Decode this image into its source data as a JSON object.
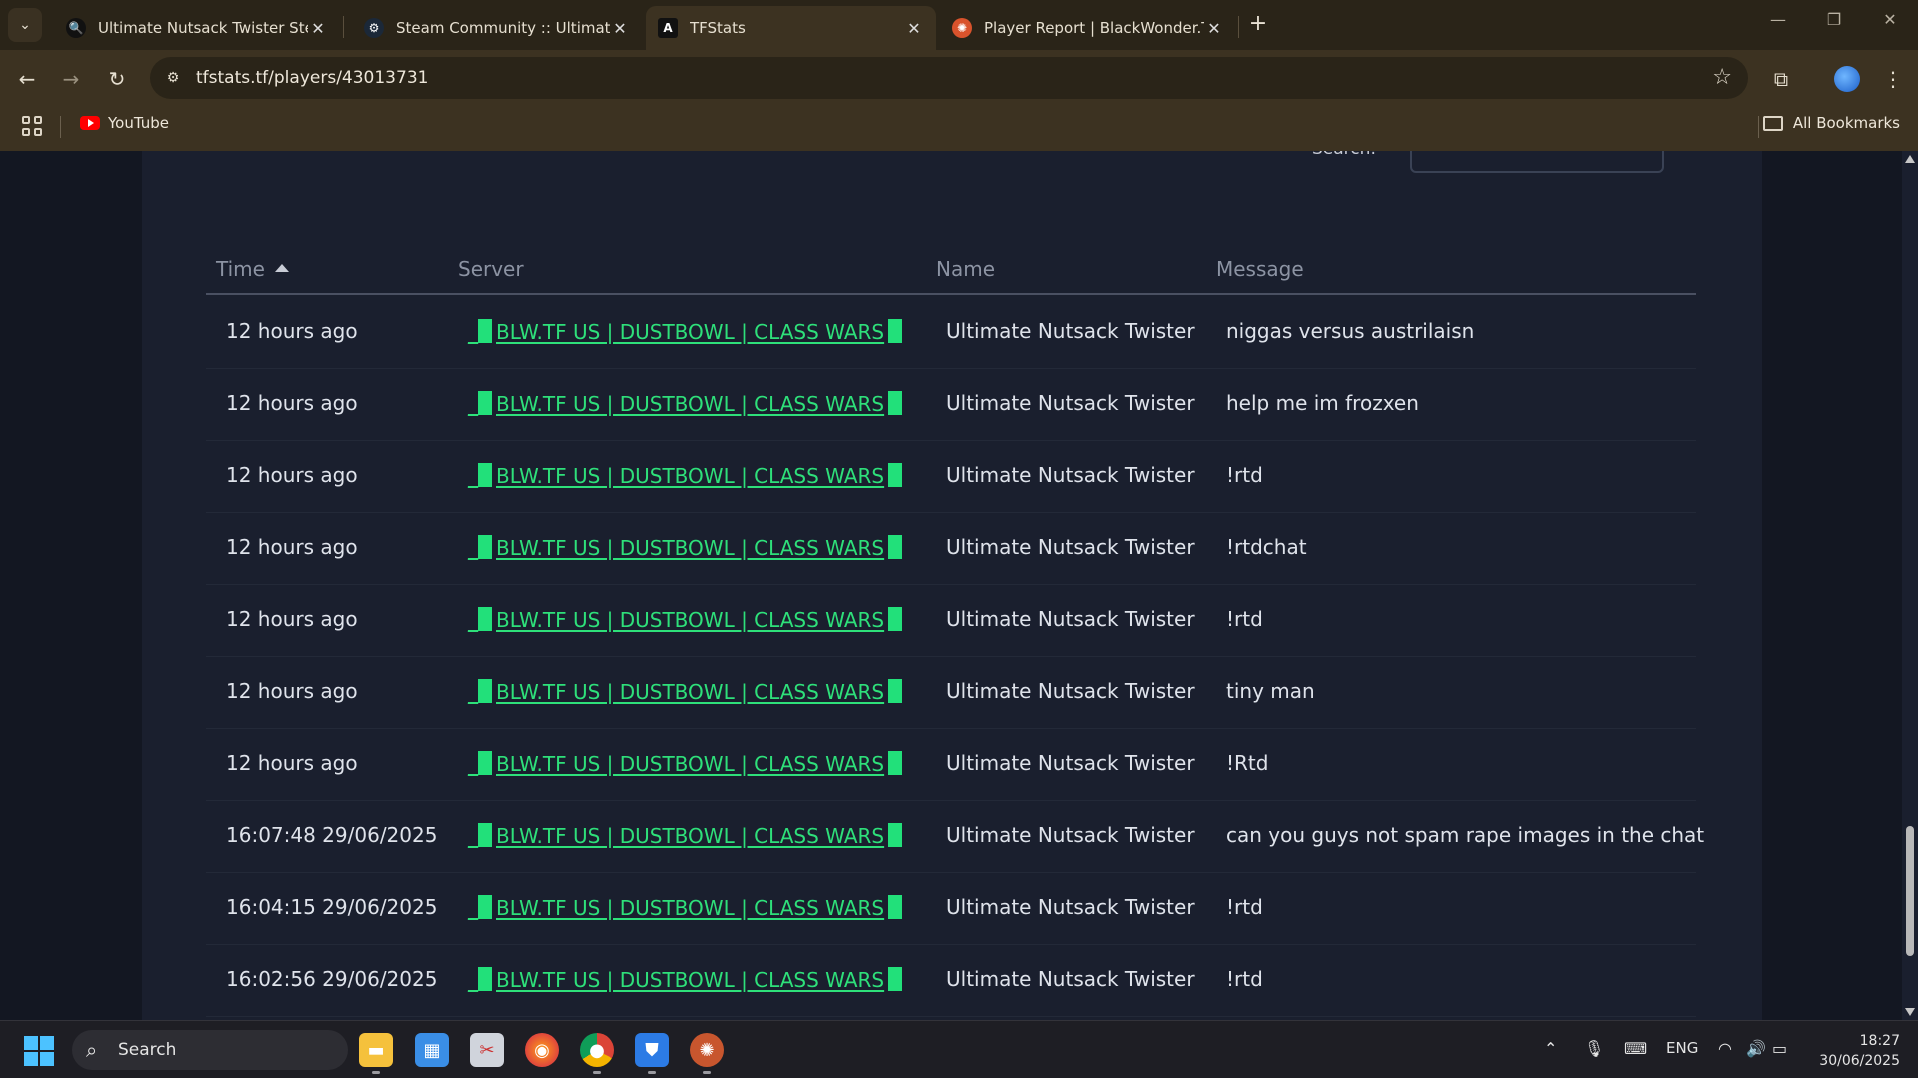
{
  "browser": {
    "tabs": [
      {
        "title": "Ultimate Nutsack Twister Steam",
        "favicon": "search-favicon"
      },
      {
        "title": "Steam Community :: Ultimate N",
        "favicon": "steam-favicon"
      },
      {
        "title": "TFStats",
        "favicon": "tfstats-favicon",
        "active": true
      },
      {
        "title": "Player Report | BlackWonder.TF",
        "favicon": "tf2-favicon"
      }
    ],
    "url": "tfstats.tf/players/43013731",
    "bookmarks": [
      {
        "label": "YouTube",
        "icon": "youtube-icon"
      }
    ],
    "all_bookmarks_label": "All Bookmarks"
  },
  "page": {
    "search_label": "Search:",
    "table": {
      "columns": [
        "Time",
        "Server",
        "Name",
        "Message"
      ],
      "sort_column": "Time",
      "server_color": "#2ee07a",
      "rows": [
        {
          "time": "12 hours ago",
          "server": "BLW.TF US | DUSTBOWL | CLASS WARS",
          "name": "Ultimate Nutsack Twister",
          "message": "niggas versus austrilaisn"
        },
        {
          "time": "12 hours ago",
          "server": "BLW.TF US | DUSTBOWL | CLASS WARS",
          "name": "Ultimate Nutsack Twister",
          "message": "help me im frozxen"
        },
        {
          "time": "12 hours ago",
          "server": "BLW.TF US | DUSTBOWL | CLASS WARS",
          "name": "Ultimate Nutsack Twister",
          "message": "!rtd"
        },
        {
          "time": "12 hours ago",
          "server": "BLW.TF US | DUSTBOWL | CLASS WARS",
          "name": "Ultimate Nutsack Twister",
          "message": "!rtdchat"
        },
        {
          "time": "12 hours ago",
          "server": "BLW.TF US | DUSTBOWL | CLASS WARS",
          "name": "Ultimate Nutsack Twister",
          "message": "!rtd"
        },
        {
          "time": "12 hours ago",
          "server": "BLW.TF US | DUSTBOWL | CLASS WARS",
          "name": "Ultimate Nutsack Twister",
          "message": "tiny man"
        },
        {
          "time": "12 hours ago",
          "server": "BLW.TF US | DUSTBOWL | CLASS WARS",
          "name": "Ultimate Nutsack Twister",
          "message": "!Rtd"
        },
        {
          "time": "16:07:48 29/06/2025",
          "server": "BLW.TF US | DUSTBOWL | CLASS WARS",
          "name": "Ultimate Nutsack Twister",
          "message": "can you guys not spam rape images in the chat"
        },
        {
          "time": "16:04:15 29/06/2025",
          "server": "BLW.TF US | DUSTBOWL | CLASS WARS",
          "name": "Ultimate Nutsack Twister",
          "message": "!rtd"
        },
        {
          "time": "16:02:56 29/06/2025",
          "server": "BLW.TF US | DUSTBOWL | CLASS WARS",
          "name": "Ultimate Nutsack Twister",
          "message": "!rtd"
        }
      ]
    }
  },
  "taskbar": {
    "search_label": "Search",
    "apps": [
      "file-explorer-icon",
      "control-panel-icon",
      "snipping-tool-icon",
      "firefox-icon",
      "chrome-icon",
      "store-icon",
      "tf2-icon"
    ],
    "language": "ENG",
    "time": "18:27",
    "date": "30/06/2025"
  }
}
